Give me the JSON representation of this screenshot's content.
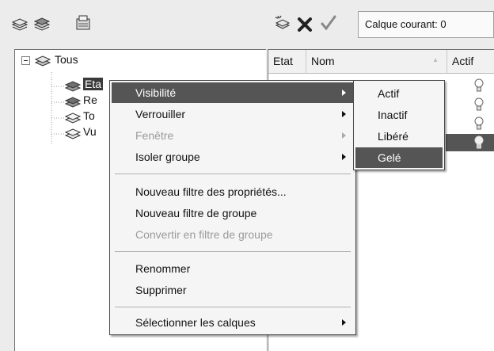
{
  "toolbar": {
    "left_icons": [
      "new-property-filter-icon",
      "new-group-filter-icon",
      "layer-states-manager-icon"
    ],
    "right_icons": [
      "new-layer-icon",
      "delete-layer-icon",
      "set-current-icon"
    ],
    "current_layer_label": "Calque courant: 0"
  },
  "tree": {
    "root": {
      "label": "Tous",
      "expander": "⊟",
      "icon": "layers-icon"
    },
    "children": [
      {
        "label": "Eta",
        "icon": "property-filter-icon",
        "selected": true
      },
      {
        "label": "Re",
        "icon": "property-filter-icon"
      },
      {
        "label": "To",
        "icon": "group-filter-icon"
      },
      {
        "label": "Vu",
        "icon": "group-filter-icon"
      }
    ]
  },
  "list": {
    "columns": [
      {
        "label": "Etat"
      },
      {
        "label": "Nom",
        "sort_indicator": "▲"
      },
      {
        "label": "Actif"
      }
    ],
    "bulb_icons": [
      "lightbulb-off-icon",
      "lightbulb-off-icon",
      "lightbulb-off-icon",
      "lightbulb-on-icon"
    ]
  },
  "context_menu": {
    "items": [
      {
        "label": "Visibilité",
        "submenu": true,
        "highlighted": true
      },
      {
        "label": "Verrouiller",
        "submenu": true
      },
      {
        "label": "Fenêtre",
        "submenu": true,
        "disabled": true
      },
      {
        "label": "Isoler groupe",
        "submenu": true
      },
      {
        "label": "Nouveau filtre des propriétés..."
      },
      {
        "label": "Nouveau filtre de groupe"
      },
      {
        "label": "Convertir en filtre de groupe",
        "disabled": true
      },
      {
        "label": "Renommer"
      },
      {
        "label": "Supprimer"
      },
      {
        "label": "Sélectionner les calques",
        "submenu": true
      }
    ]
  },
  "submenu": {
    "items": [
      {
        "label": "Actif"
      },
      {
        "label": "Inactif"
      },
      {
        "label": "Libéré"
      },
      {
        "label": "Gelé",
        "highlighted": true
      }
    ]
  }
}
